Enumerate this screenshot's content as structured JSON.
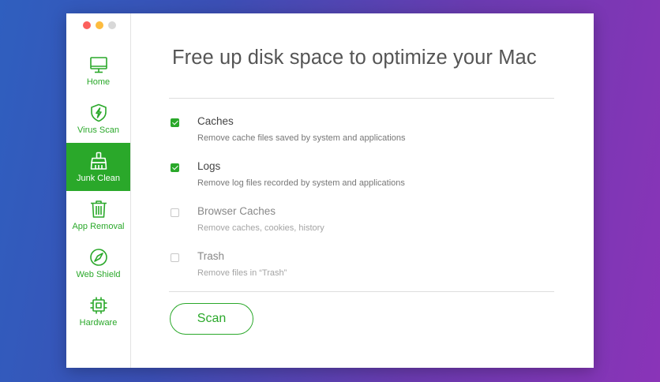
{
  "window": {
    "traffic_lights": [
      "close",
      "minimize",
      "zoom"
    ]
  },
  "sidebar": {
    "items": [
      {
        "label": "Home",
        "icon": "monitor-icon",
        "active": false
      },
      {
        "label": "Virus Scan",
        "icon": "shield-bolt-icon",
        "active": false
      },
      {
        "label": "Junk Clean",
        "icon": "broom-icon",
        "active": true
      },
      {
        "label": "App Removal",
        "icon": "trash-icon",
        "active": false
      },
      {
        "label": "Web Shield",
        "icon": "compass-icon",
        "active": false
      },
      {
        "label": "Hardware",
        "icon": "chip-icon",
        "active": false
      }
    ]
  },
  "main": {
    "title": "Free up disk space to optimize your Mac",
    "options": [
      {
        "label": "Caches",
        "description": "Remove cache files saved by system and applications",
        "checked": true
      },
      {
        "label": "Logs",
        "description": "Remove log files recorded by system and applications",
        "checked": true
      },
      {
        "label": "Browser Caches",
        "description": "Remove caches, cookies, history",
        "checked": false
      },
      {
        "label": "Trash",
        "description": "Remove files in “Trash”",
        "checked": false
      }
    ],
    "scan_label": "Scan"
  },
  "colors": {
    "accent": "#2aa82a",
    "title_text": "#555555",
    "background_start": "#2f5fbf",
    "background_end": "#8a34b8"
  }
}
